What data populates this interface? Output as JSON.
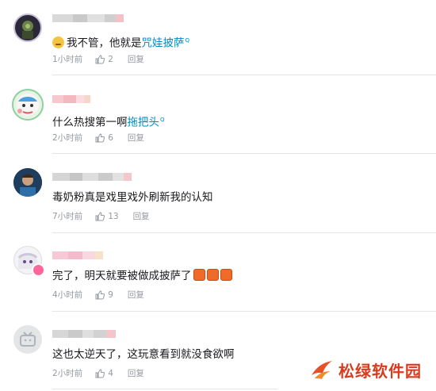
{
  "comments": [
    {
      "text_prefix": "我不管，他就是",
      "link_text": "咒娃披萨",
      "has_emoji_prefix": true,
      "time": "1小时前",
      "likes": "2",
      "reply": "回复",
      "avatar": "dark-armored-character-avatar"
    },
    {
      "text_prefix": "什么热搜第一啊",
      "link_text": "拖把头",
      "time": "2小时前",
      "likes": "6",
      "reply": "回复",
      "avatar": "anime-character-avatar"
    },
    {
      "text_prefix": "毒奶粉真是戏里戏外刷新我的认知",
      "time": "7小时前",
      "likes": "13",
      "reply": "回复",
      "avatar": "man-photo-avatar"
    },
    {
      "text_prefix": "完了，明天就要被做成披萨了",
      "emoji_suffix": "fire-emoji x3",
      "time": "4小时前",
      "likes": "9",
      "reply": "回复",
      "avatar": "white-hair-anime-avatar"
    },
    {
      "text_prefix": "这也太逆天了，这玩意看到就没食欲啊",
      "time": "2小时前",
      "likes": "4",
      "reply": "回复",
      "avatar": "default-tv-avatar"
    }
  ],
  "watermark": {
    "text": "松绿软件园"
  },
  "colors": {
    "link": "#008ac5",
    "meta": "#9499a0",
    "watermark": "#d73c1e"
  }
}
